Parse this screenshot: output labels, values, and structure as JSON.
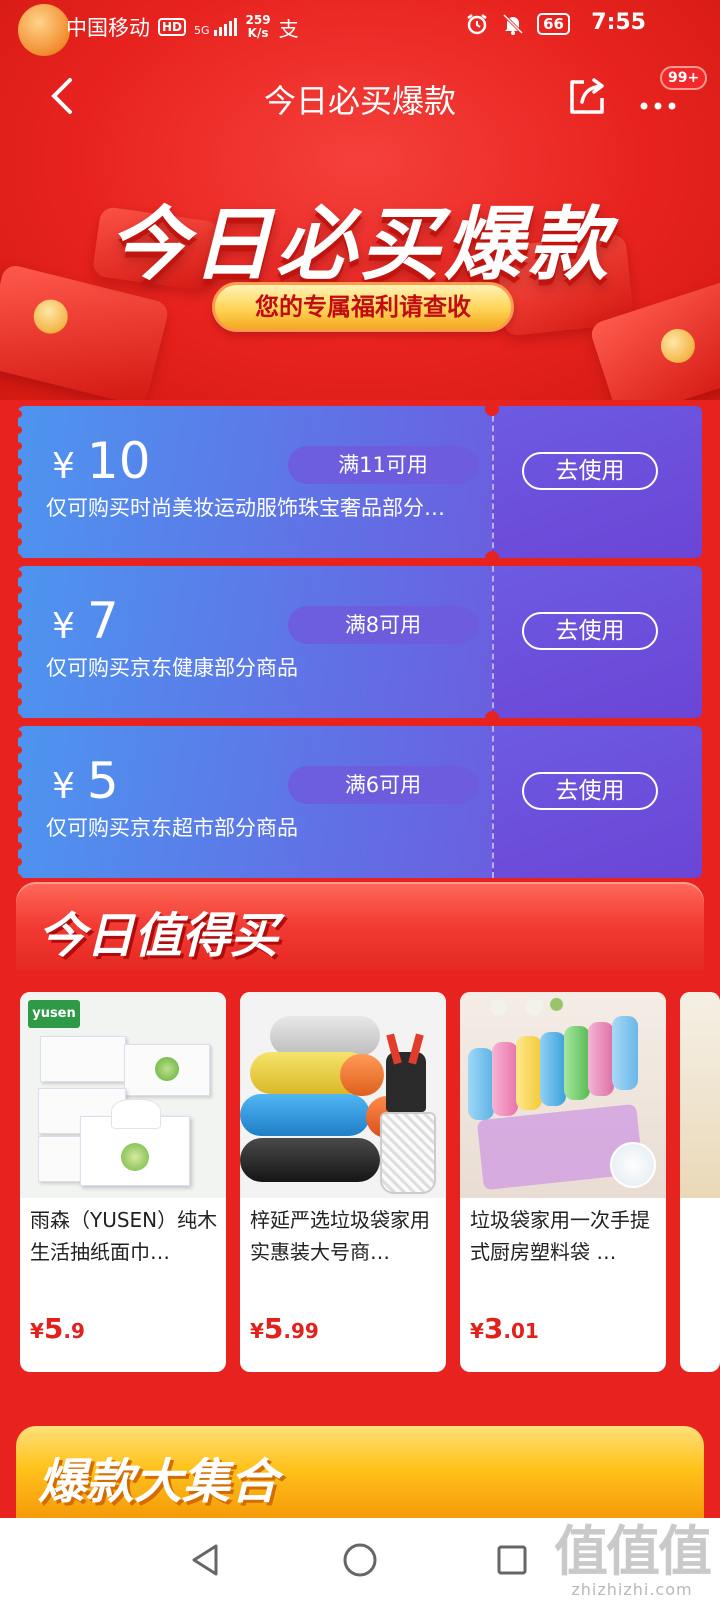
{
  "status_bar": {
    "carrier": "中国移动",
    "hd": "HD",
    "signal": "5G",
    "speed_value": "259",
    "speed_unit": "K/s",
    "battery": "66",
    "time": "7:55"
  },
  "nav": {
    "title": "今日必买爆款",
    "badge": "99+"
  },
  "banner": {
    "title": "今日必买爆款",
    "subtitle": "您的专属福利请查收"
  },
  "coupons": [
    {
      "currency": "¥",
      "amount": "10",
      "condition": "满11可用",
      "description": "仅可购买时尚美妆运动服饰珠宝奢品部分…",
      "button": "去使用"
    },
    {
      "currency": "¥",
      "amount": "7",
      "condition": "满8可用",
      "description": "仅可购买京东健康部分商品",
      "button": "去使用"
    },
    {
      "currency": "¥",
      "amount": "5",
      "condition": "满6可用",
      "description": "仅可购买京东超市部分商品",
      "button": "去使用"
    }
  ],
  "worth_section": {
    "title": "今日值得买",
    "products": [
      {
        "name": "雨森（YUSEN）纯木生活抽纸面巾…",
        "currency": "¥",
        "price_int": "5",
        "price_dec": ".9",
        "brand": "yusen"
      },
      {
        "name": "梓延严选垃圾袋家用实惠装大号商…",
        "currency": "¥",
        "price_int": "5",
        "price_dec": ".99"
      },
      {
        "name": "垃圾袋家用一次手提式厨房塑料袋 …",
        "currency": "¥",
        "price_int": "3",
        "price_dec": ".01"
      }
    ]
  },
  "hot_section": {
    "title": "爆款大集合"
  },
  "watermark": {
    "logo": "值值值",
    "url": "zhizhizhi.com"
  },
  "colors": {
    "page_red": "#e8231f",
    "coupon_blue": "#4d95ef",
    "coupon_purple": "#6b45d6",
    "price_red": "#e3201a",
    "hot_yellow": "#ffc31c"
  }
}
